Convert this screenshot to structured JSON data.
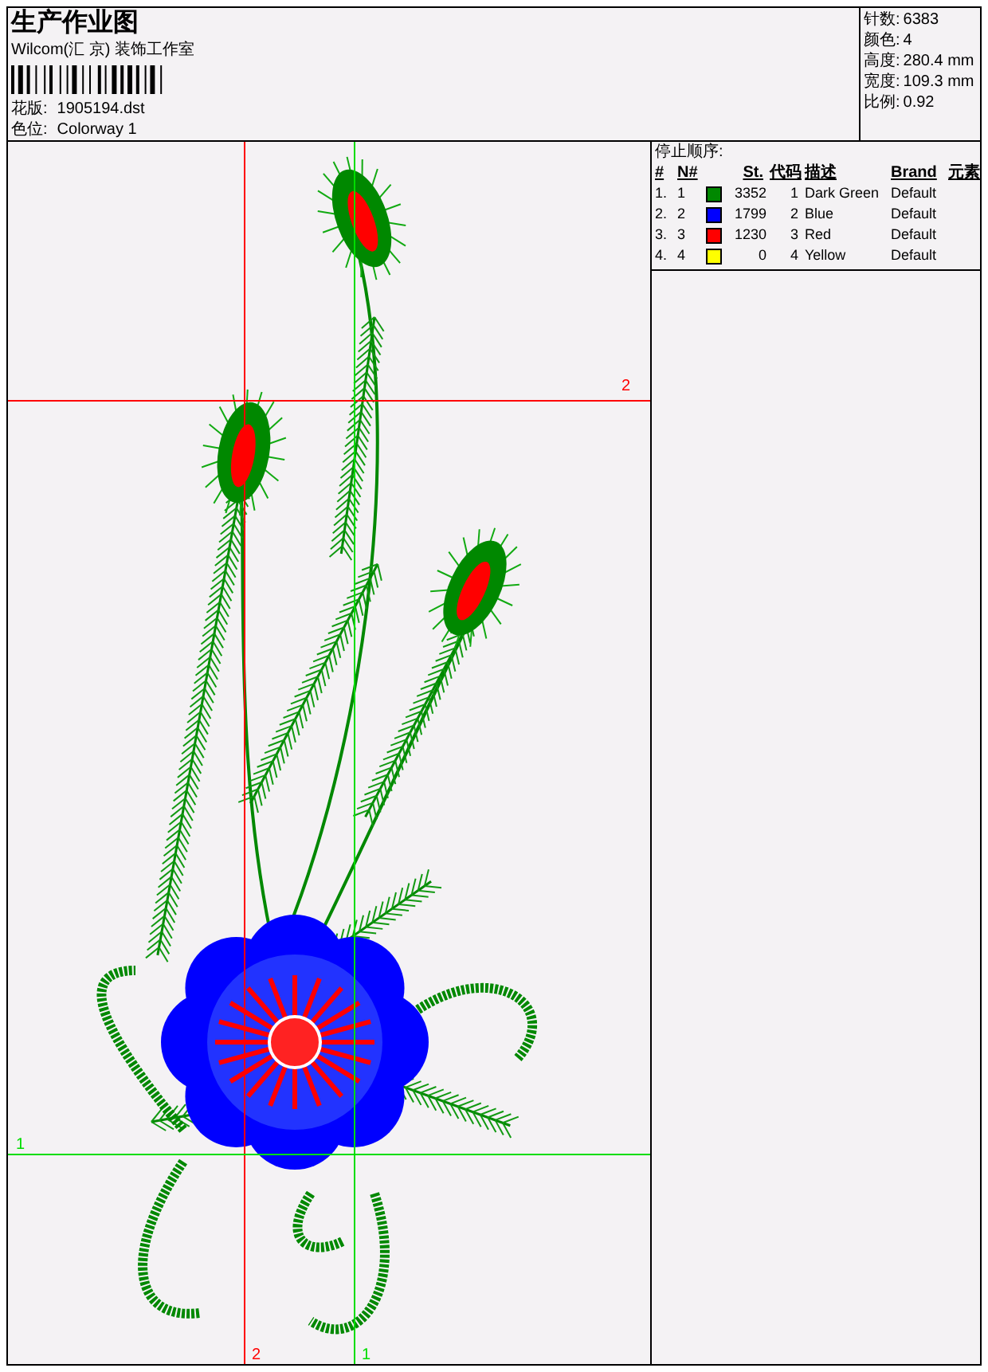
{
  "header": {
    "title": "生产作业图",
    "company": "Wilcom(汇 京) 装饰工作室",
    "design_label": "花版:",
    "design_value": "1905194.dst",
    "colorway_label": "色位:",
    "colorway_value": "Colorway 1"
  },
  "stats": [
    {
      "label": "针数:",
      "value": "6383"
    },
    {
      "label": "颜色:",
      "value": "4"
    },
    {
      "label": "高度:",
      "value": "280.4 mm"
    },
    {
      "label": "宽度:",
      "value": "109.3 mm"
    },
    {
      "label": "比例:",
      "value": "0.92"
    }
  ],
  "stop_sequence": {
    "title": "停止顺序:",
    "columns": [
      "#",
      "N#",
      "St.",
      "代码",
      "描述",
      "Brand",
      "元素"
    ],
    "rows": [
      {
        "index": "1.",
        "needle": "1",
        "color": "#008800",
        "stitches": "3352",
        "code": "1",
        "description": "Dark Green",
        "brand": "Default"
      },
      {
        "index": "2.",
        "needle": "2",
        "color": "#0000ff",
        "stitches": "1799",
        "code": "2",
        "description": "Blue",
        "brand": "Default"
      },
      {
        "index": "3.",
        "needle": "3",
        "color": "#ff0000",
        "stitches": "1230",
        "code": "3",
        "description": "Red",
        "brand": "Default"
      },
      {
        "index": "4.",
        "needle": "4",
        "color": "#ffff00",
        "stitches": "0",
        "code": "4",
        "description": "Yellow",
        "brand": "Default"
      }
    ]
  },
  "guides": [
    {
      "label": "2",
      "kind": "vertical",
      "color": "#ff0000"
    },
    {
      "label": "2",
      "kind": "horizontal",
      "color": "#ff0000"
    },
    {
      "label": "1",
      "kind": "vertical",
      "color": "#00dd00"
    },
    {
      "label": "1",
      "kind": "horizontal",
      "color": "#00dd00"
    }
  ]
}
